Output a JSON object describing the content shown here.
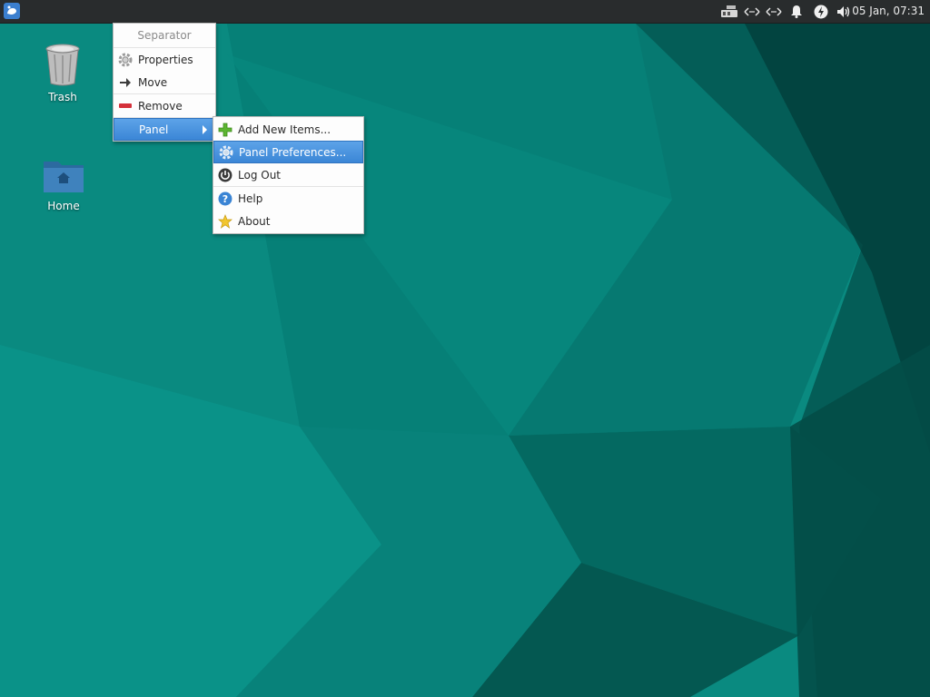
{
  "panel": {
    "clock": "05 Jan, 07:31",
    "tray_icons": [
      "network-wired-icon",
      "network-arrows-icon",
      "network-arrows-icon",
      "notification-bell-icon",
      "power-icon",
      "volume-icon"
    ]
  },
  "desktop_icons": [
    {
      "label": "Trash",
      "icon": "trash-icon"
    },
    {
      "label": "Home",
      "icon": "home-folder-icon"
    }
  ],
  "context_menu": {
    "title": "Separator",
    "items": [
      {
        "label": "Properties",
        "icon": "gear-icon"
      },
      {
        "label": "Move",
        "icon": "arrow-right-icon"
      },
      {
        "label": "Remove",
        "icon": "remove-icon"
      },
      {
        "label": "Panel",
        "icon": "",
        "has_submenu": true,
        "active": true
      }
    ]
  },
  "panel_submenu": {
    "items": [
      {
        "label": "Add New Items...",
        "icon": "plus-icon"
      },
      {
        "label": "Panel Preferences...",
        "icon": "gear-icon",
        "active": true
      },
      {
        "label": "Log Out",
        "icon": "logout-icon"
      },
      {
        "label": "Help",
        "icon": "help-icon"
      },
      {
        "label": "About",
        "icon": "star-icon"
      }
    ]
  },
  "colors": {
    "accent": "#3b86d6",
    "wallpaper_base": "#04786f",
    "panel_bg": "#292c2d"
  }
}
